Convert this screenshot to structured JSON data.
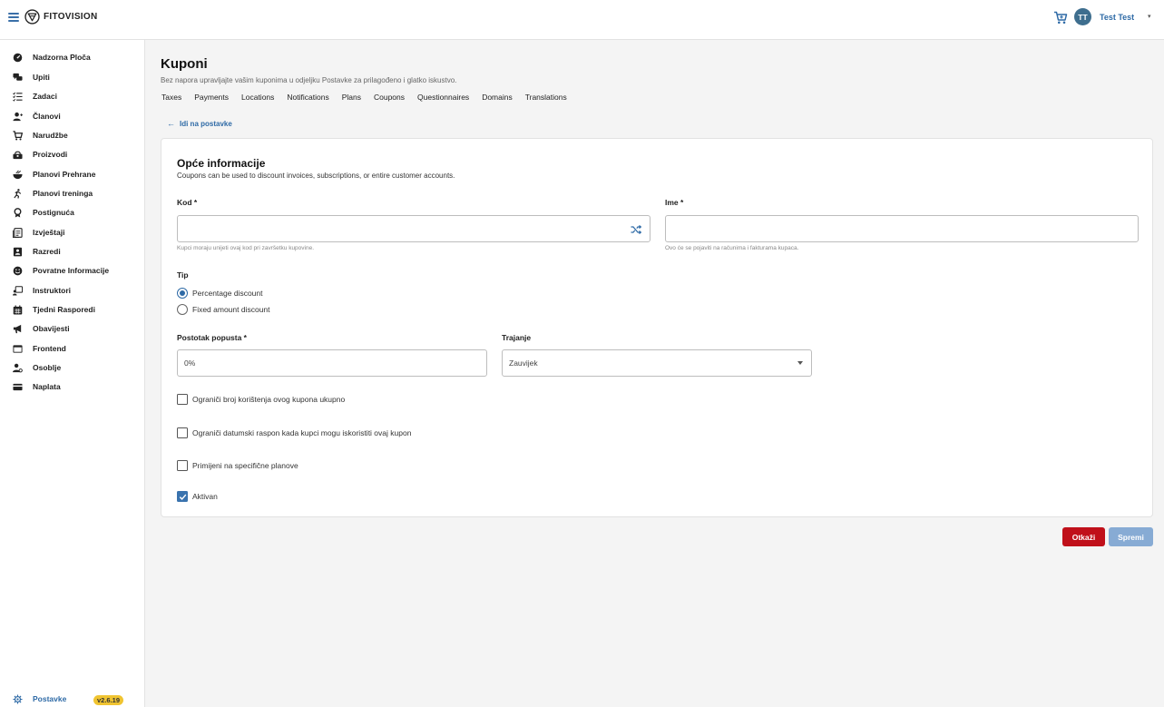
{
  "header": {
    "brand": "FITOVISION",
    "user_initials": "TT",
    "user_name": "Test Test",
    "caret": "▾"
  },
  "sidebar": {
    "items": [
      {
        "label": "Nadzorna Ploča",
        "icon": "dashboard-icon"
      },
      {
        "label": "Upiti",
        "icon": "chat-icon"
      },
      {
        "label": "Zadaci",
        "icon": "checklist-icon"
      },
      {
        "label": "Članovi",
        "icon": "members-icon"
      },
      {
        "label": "Narudžbe",
        "icon": "cart-icon"
      },
      {
        "label": "Proizvodi",
        "icon": "products-icon"
      },
      {
        "label": "Planovi Prehrane",
        "icon": "food-bowl-icon"
      },
      {
        "label": "Planovi treninga",
        "icon": "running-icon"
      },
      {
        "label": "Postignuća",
        "icon": "award-icon"
      },
      {
        "label": "Izvještaji",
        "icon": "report-icon"
      },
      {
        "label": "Razredi",
        "icon": "classes-icon"
      },
      {
        "label": "Povratne Informacije",
        "icon": "smiley-icon"
      },
      {
        "label": "Instruktori",
        "icon": "instructor-icon"
      },
      {
        "label": "Tjedni Rasporedi",
        "icon": "calendar-icon"
      },
      {
        "label": "Obavijesti",
        "icon": "megaphone-icon"
      },
      {
        "label": "Frontend",
        "icon": "window-icon"
      },
      {
        "label": "Osoblje",
        "icon": "staff-icon"
      },
      {
        "label": "Naplata",
        "icon": "credit-card-icon"
      }
    ],
    "settings_label": "Postavke",
    "version": "v2.6.19"
  },
  "page": {
    "title": "Kuponi",
    "subtitle": "Bez napora upravljajte vašim kuponima u odjeljku Postavke za prilagođeno i glatko iskustvo.",
    "tabs": [
      "Taxes",
      "Payments",
      "Locations",
      "Notifications",
      "Plans",
      "Coupons",
      "Questionnaires",
      "Domains",
      "Translations"
    ],
    "back_link": "Idi na postavke"
  },
  "form": {
    "section_title": "Opće informacije",
    "section_desc": "Coupons can be used to discount invoices, subscriptions, or entire customer accounts.",
    "code_label": "Kod *",
    "code_value": "",
    "code_hint": "Kupci moraju unijeti ovaj kod pri završetku kupovine.",
    "name_label": "Ime *",
    "name_value": "",
    "name_hint": "Ovo će se pojaviti na računima i fakturama kupaca.",
    "type_label": "Tip",
    "type_options": [
      {
        "label": "Percentage discount",
        "selected": true
      },
      {
        "label": "Fixed amount discount",
        "selected": false
      }
    ],
    "percent_label": "Postotak popusta *",
    "percent_value": "0%",
    "duration_label": "Trajanje",
    "duration_value": "Zauvijek",
    "checks": [
      {
        "label": "Ograniči broj korištenja ovog kupona ukupno",
        "checked": false
      },
      {
        "label": "Ograniči datumski raspon kada kupci mogu iskoristiti ovaj kupon",
        "checked": false
      },
      {
        "label": "Primijeni na specifične planove",
        "checked": false
      },
      {
        "label": "Aktivan",
        "checked": true
      }
    ]
  },
  "actions": {
    "cancel": "Otkaži",
    "save": "Spremi"
  },
  "colors": {
    "accent": "#2e6aa6",
    "danger": "#c0101a",
    "save_disabled": "#87abd4",
    "version_badge": "#f0c431"
  }
}
